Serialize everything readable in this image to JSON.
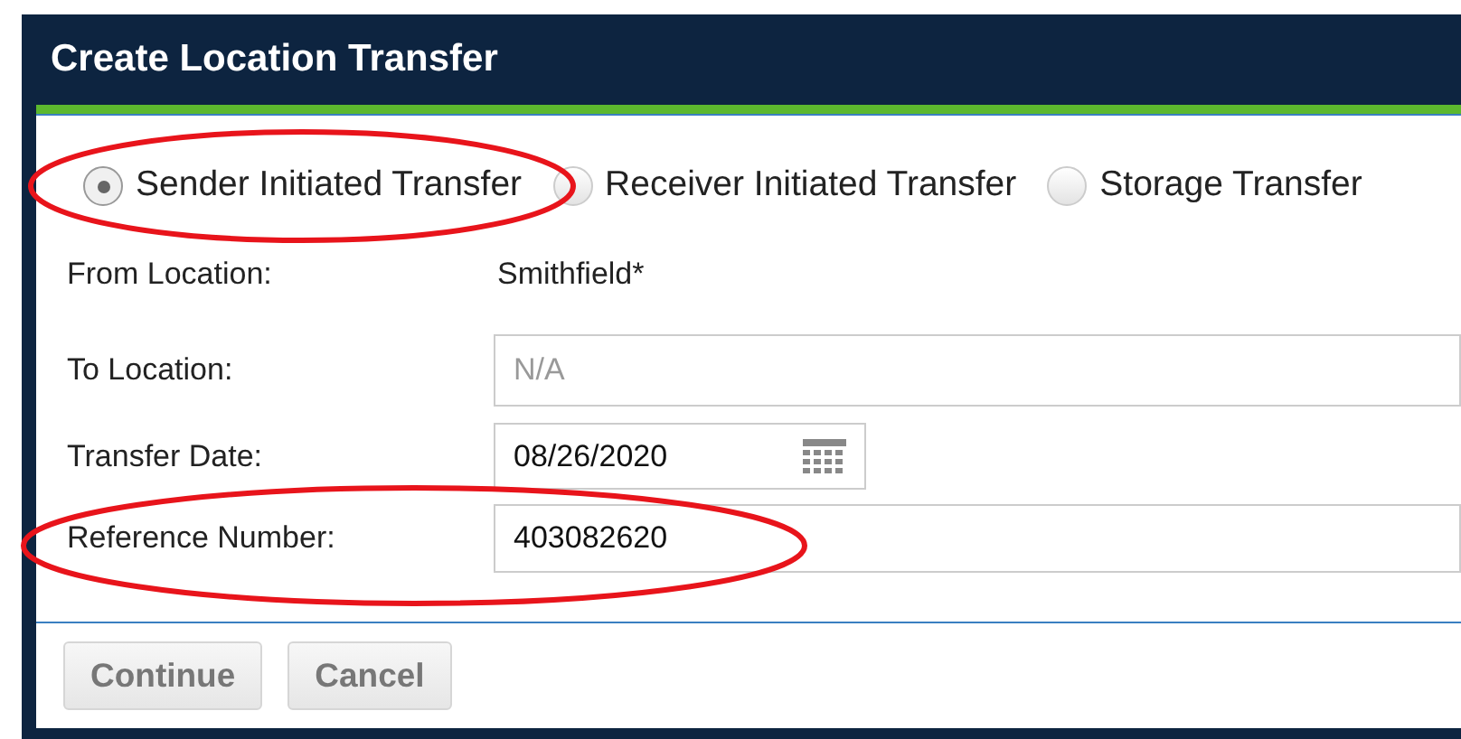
{
  "dialog": {
    "title": "Create Location Transfer"
  },
  "transfer_types": [
    {
      "label": "Sender Initiated Transfer",
      "selected": true
    },
    {
      "label": "Receiver Initiated Transfer",
      "selected": false
    },
    {
      "label": "Storage Transfer",
      "selected": false
    }
  ],
  "from_location": {
    "label": "From Location:",
    "value": "Smithfield*"
  },
  "to_location": {
    "label": "To Location:",
    "placeholder": "N/A"
  },
  "transfer_date": {
    "label": "Transfer Date:",
    "value": "08/26/2020"
  },
  "reference_number": {
    "label": "Reference Number:",
    "value": "403082620"
  },
  "buttons": [
    "Continue",
    "Cancel"
  ]
}
